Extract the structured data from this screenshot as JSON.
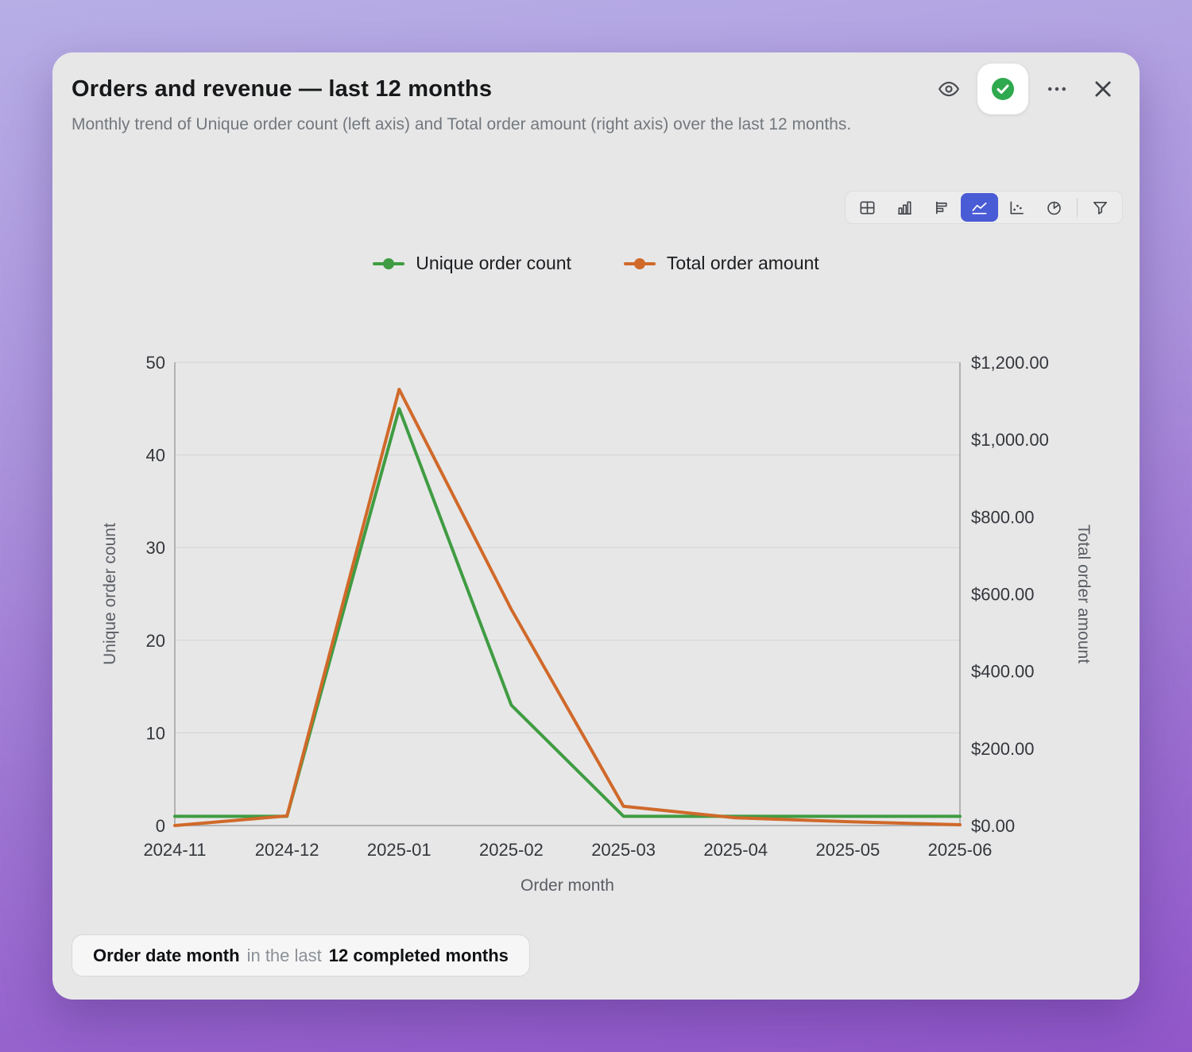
{
  "colors": {
    "accent_blue": "#4a5bd6",
    "series_green": "#3f9c42",
    "series_orange": "#d0692a",
    "check_green": "#2fa94e"
  },
  "header": {
    "title": "Orders and revenue — last 12 months",
    "subtitle": "Monthly trend of Unique order count (left axis) and Total order amount (right axis) over the last 12 months."
  },
  "header_actions": {
    "icons": [
      "eye-icon",
      "check-circle-icon",
      "ellipsis-icon",
      "close-icon"
    ]
  },
  "toolbar": {
    "tools": [
      {
        "name": "table",
        "selected": false
      },
      {
        "name": "bar-chart",
        "selected": false
      },
      {
        "name": "horizontal-bar-chart",
        "selected": false
      },
      {
        "name": "area-chart",
        "selected": true
      },
      {
        "name": "scatter-chart",
        "selected": false
      },
      {
        "name": "pie-chart",
        "selected": false
      },
      {
        "name": "filter",
        "selected": false
      }
    ]
  },
  "legend": {
    "items": [
      {
        "label": "Unique order count",
        "color": "#3f9c42"
      },
      {
        "label": "Total order amount",
        "color": "#d0692a"
      }
    ]
  },
  "chart_data": {
    "type": "line",
    "x_label": "Order month",
    "x": [
      "2024-11",
      "2024-12",
      "2025-01",
      "2025-02",
      "2025-03",
      "2025-04",
      "2025-05",
      "2025-06"
    ],
    "series": [
      {
        "name": "Unique order count",
        "axis": "left",
        "color": "#3f9c42",
        "values": [
          1,
          1,
          45,
          13,
          1,
          1,
          1,
          1
        ]
      },
      {
        "name": "Total order amount",
        "axis": "right",
        "color": "#d0692a",
        "values": [
          0,
          25,
          1130,
          560,
          50,
          20,
          10,
          2
        ]
      }
    ],
    "left_axis": {
      "label": "Unique order count",
      "range": [
        0,
        50
      ],
      "ticks": [
        0,
        10,
        20,
        30,
        40,
        50
      ]
    },
    "right_axis": {
      "label": "Total order amount",
      "range": [
        0,
        1200
      ],
      "ticks": [
        {
          "value": 0,
          "label": "$0.00"
        },
        {
          "value": 200,
          "label": "$200.00"
        },
        {
          "value": 400,
          "label": "$400.00"
        },
        {
          "value": 600,
          "label": "$600.00"
        },
        {
          "value": 800,
          "label": "$800.00"
        },
        {
          "value": 1000,
          "label": "$1,000.00"
        },
        {
          "value": 1200,
          "label": "$1,200.00"
        }
      ]
    },
    "grid": "horizontal",
    "legend_position": "top"
  },
  "filter": {
    "field": "Order date month",
    "connector": "in the last",
    "value": "12 completed months"
  }
}
